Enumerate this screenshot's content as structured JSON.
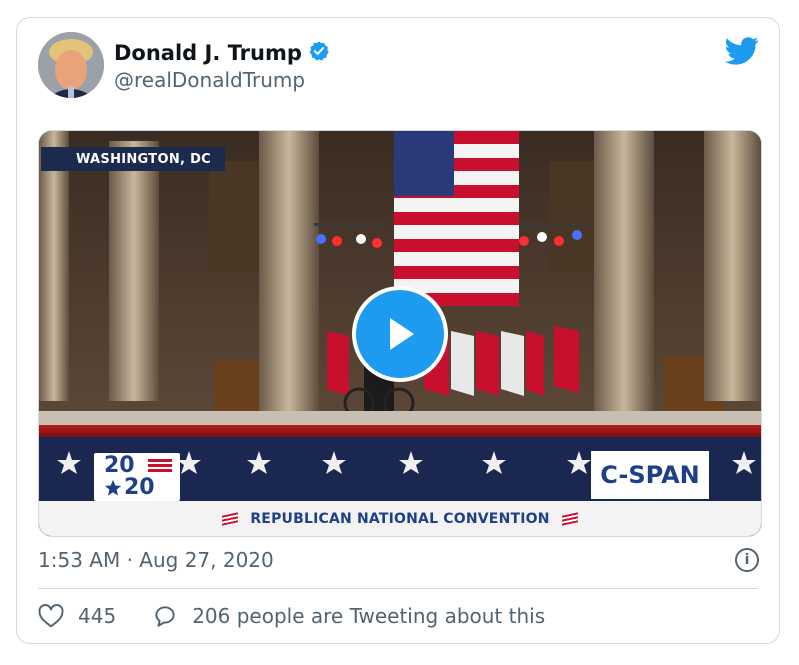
{
  "author": {
    "name": "Donald J. Trump",
    "handle": "@realDonaldTrump",
    "verified": true
  },
  "media": {
    "location_badge": "WASHINGTON, DC",
    "logo_year_top": "20",
    "logo_year_bottom": "20",
    "network": "C-SPAN",
    "banner": "REPUBLICAN NATIONAL CONVENTION"
  },
  "timestamp": "1:53 AM · Aug 27, 2020",
  "actions": {
    "likes": "445",
    "conversation": "206 people are Tweeting about this"
  },
  "colors": {
    "accent": "#1d9bf0",
    "muted": "#536471",
    "navy": "#1f3f88",
    "flag_red": "#c8102e"
  }
}
